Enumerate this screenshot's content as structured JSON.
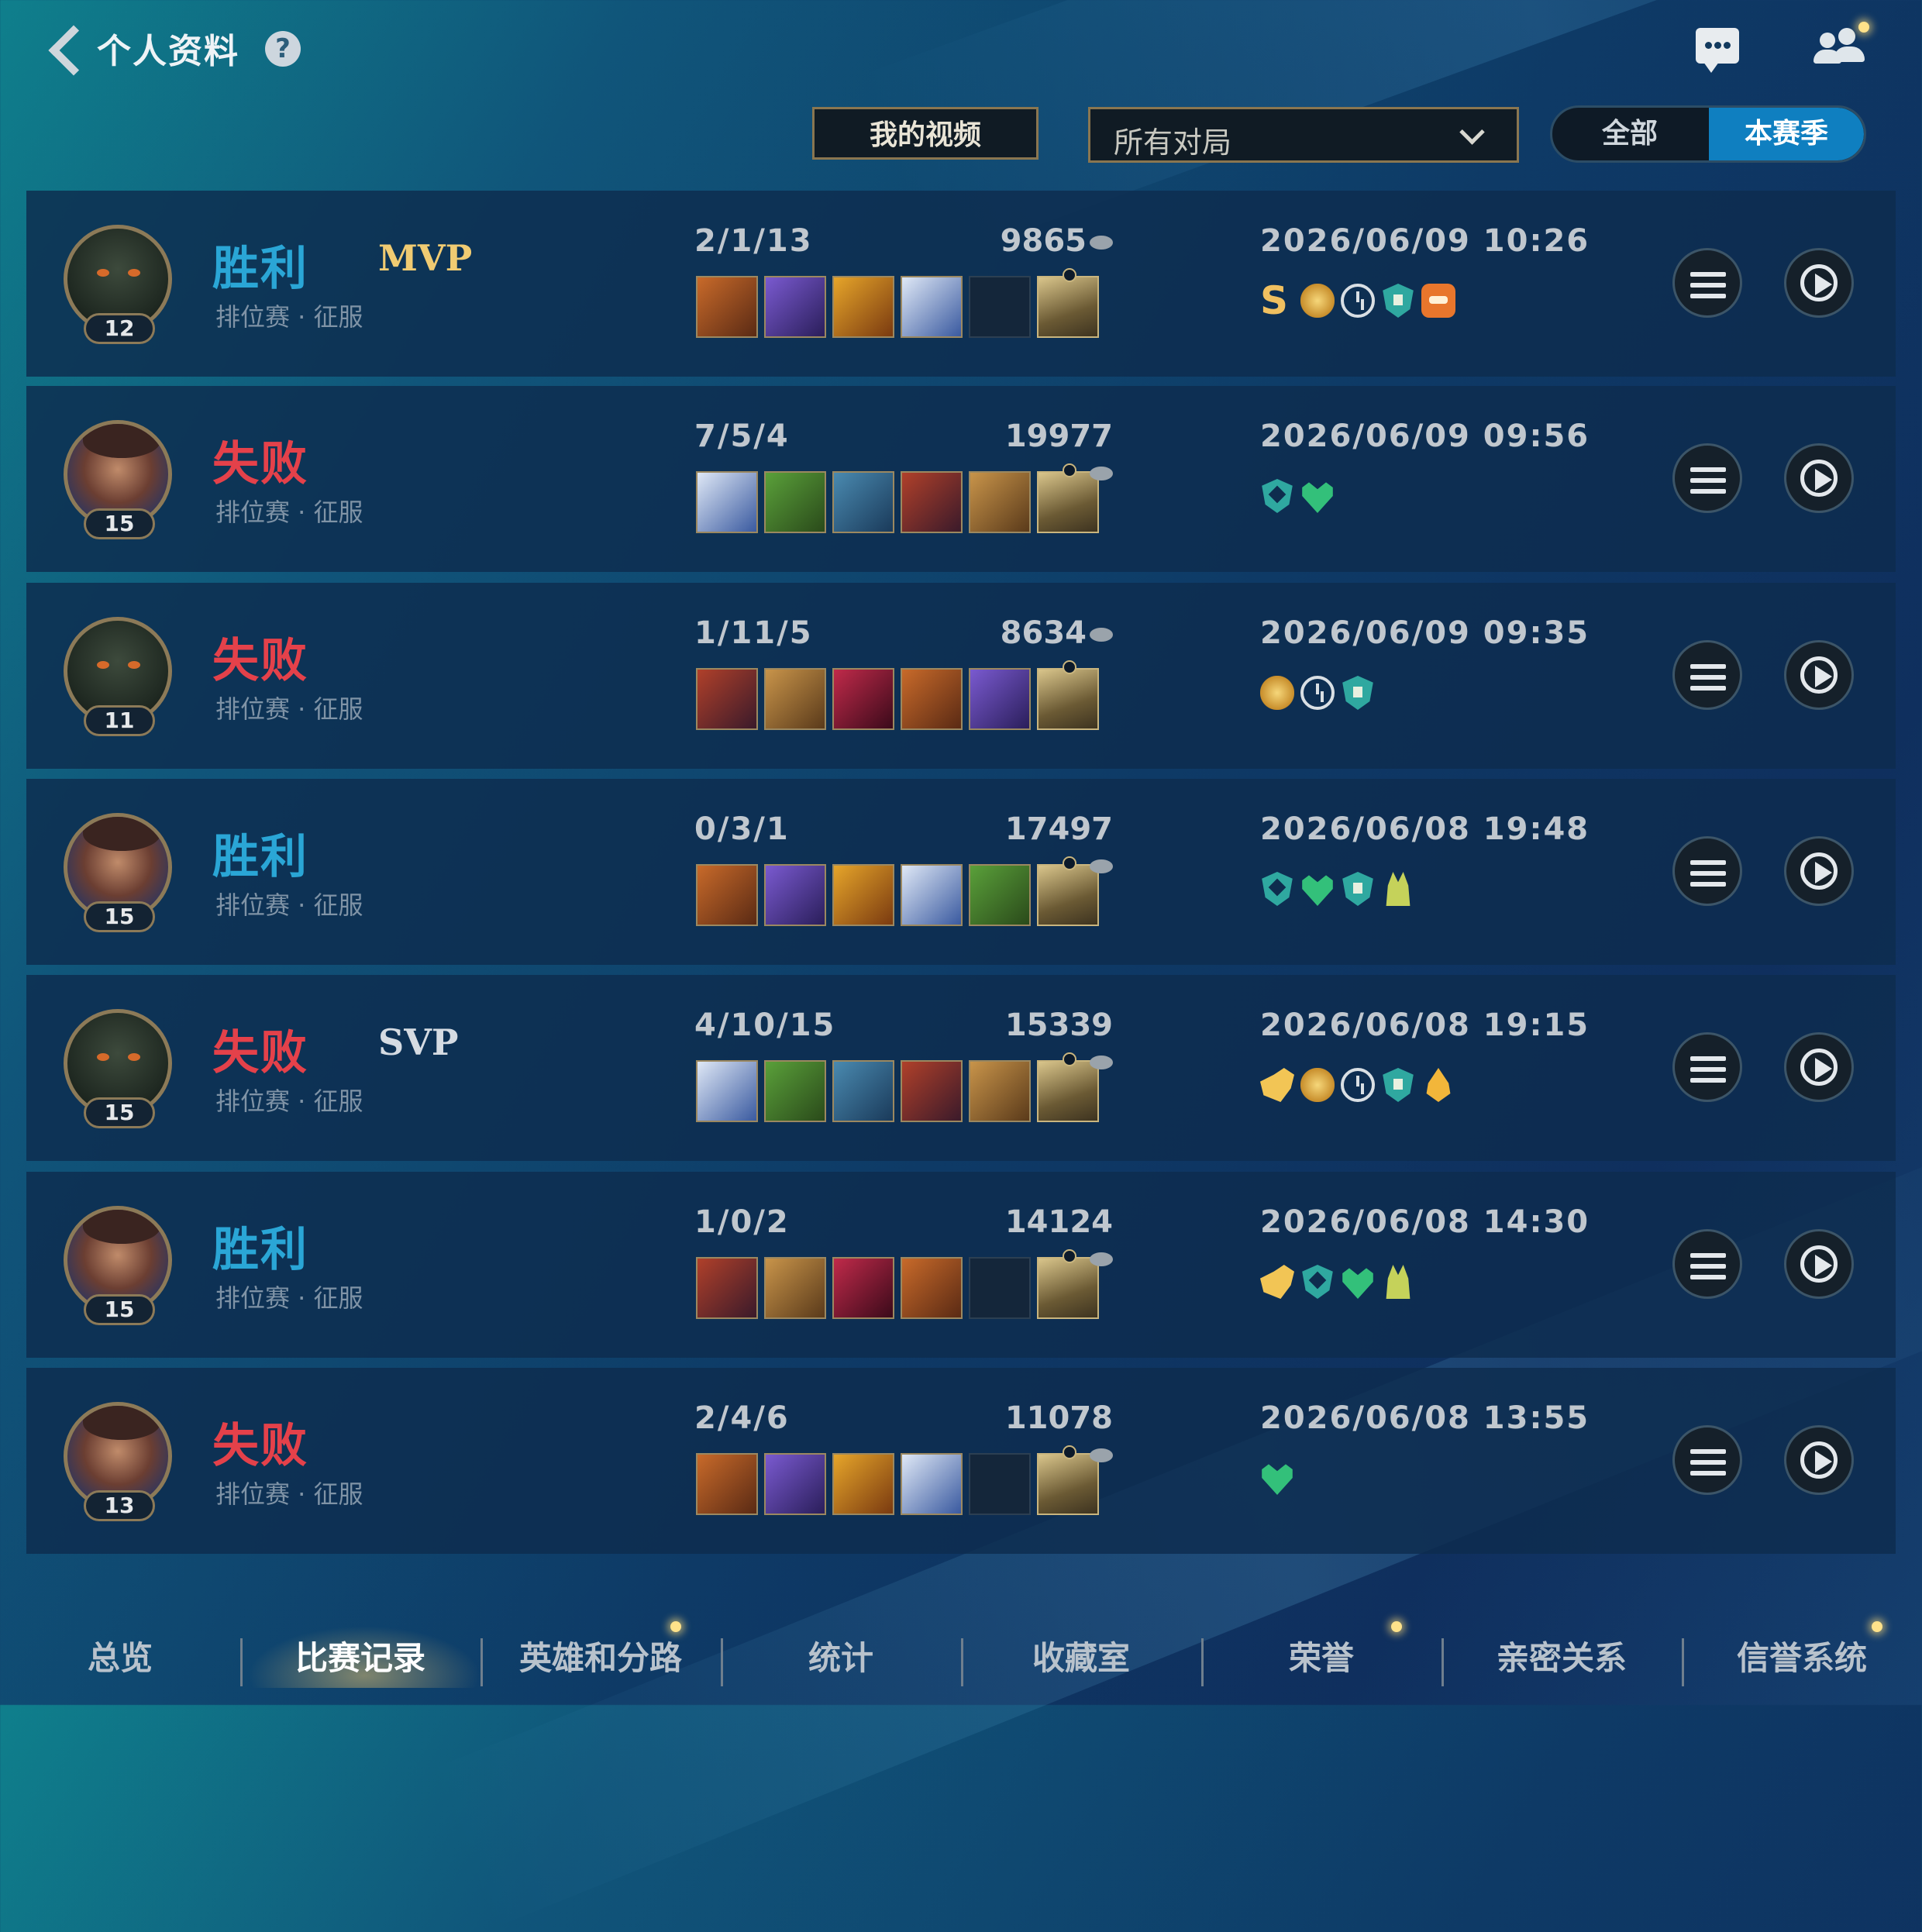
{
  "header": {
    "title": "个人资料",
    "help": "?"
  },
  "filters": {
    "my_video": "我的视频",
    "match_type": "所有对局",
    "toggle_all": "全部",
    "toggle_season": "本赛季"
  },
  "colors": {
    "win": "#2aa6d6",
    "loss": "#e4414a",
    "mvp": "#f0cb72",
    "accent_blue": "#0f7fc0"
  },
  "matches": [
    {
      "result": "胜利",
      "outcome": "win",
      "badge": "MVP",
      "mode": "排位赛 · 征服",
      "level": "12",
      "avatar": "champion-a",
      "kda": "2/1/13",
      "gold": "9865",
      "time": "2026/06/09 10:26",
      "awards": [
        "s-grade",
        "gold-hand-icon",
        "clock-icon",
        "tower-shield-icon",
        "orange-badge-icon"
      ],
      "items": [
        "item",
        "item",
        "item",
        "item",
        "empty",
        "trinket"
      ]
    },
    {
      "result": "失败",
      "outcome": "loss",
      "badge": "",
      "mode": "排位赛 · 征服",
      "level": "15",
      "avatar": "champion-b",
      "kda": "7/5/4",
      "gold": "19977",
      "time": "2026/06/09 09:56",
      "awards": [
        "shield-icon",
        "heal-heart-icon"
      ],
      "items": [
        "item",
        "item",
        "item",
        "item",
        "item",
        "trinket"
      ]
    },
    {
      "result": "失败",
      "outcome": "loss",
      "badge": "",
      "mode": "排位赛 · 征服",
      "level": "11",
      "avatar": "champion-a",
      "kda": "1/11/5",
      "gold": "8634",
      "time": "2026/06/09 09:35",
      "awards": [
        "gold-hand-icon",
        "clock-icon",
        "tower-shield-icon"
      ],
      "items": [
        "item",
        "item",
        "item",
        "item",
        "item",
        "trinket"
      ]
    },
    {
      "result": "胜利",
      "outcome": "win",
      "badge": "",
      "mode": "排位赛 · 征服",
      "level": "15",
      "avatar": "champion-b",
      "kda": "0/3/1",
      "gold": "17497",
      "time": "2026/06/08 19:48",
      "awards": [
        "shield-icon",
        "heal-heart-icon",
        "tower-shield-icon",
        "king-icon"
      ],
      "items": [
        "item",
        "item",
        "item",
        "item",
        "item",
        "trinket"
      ]
    },
    {
      "result": "失败",
      "outcome": "loss",
      "badge": "SVP",
      "mode": "排位赛 · 征服",
      "level": "15",
      "avatar": "champion-a",
      "kda": "4/10/15",
      "gold": "15339",
      "time": "2026/06/08 19:15",
      "awards": [
        "hand-icon",
        "gold-hand-icon",
        "clock-icon",
        "tower-shield-icon",
        "flame-icon"
      ],
      "items": [
        "item",
        "item",
        "item",
        "item",
        "item",
        "trinket"
      ]
    },
    {
      "result": "胜利",
      "outcome": "win",
      "badge": "",
      "mode": "排位赛 · 征服",
      "level": "15",
      "avatar": "champion-b",
      "kda": "1/0/2",
      "gold": "14124",
      "time": "2026/06/08 14:30",
      "awards": [
        "hand-icon",
        "shield-icon",
        "heal-heart-icon",
        "king-icon"
      ],
      "items": [
        "item",
        "item",
        "item",
        "item",
        "empty",
        "trinket"
      ]
    },
    {
      "result": "失败",
      "outcome": "loss",
      "badge": "",
      "mode": "排位赛 · 征服",
      "level": "13",
      "avatar": "champion-b",
      "kda": "2/4/6",
      "gold": "11078",
      "time": "2026/06/08 13:55",
      "awards": [
        "heal-heart-icon"
      ],
      "items": [
        "item",
        "item",
        "item",
        "item",
        "empty",
        "trinket"
      ]
    }
  ],
  "nav": [
    {
      "label": "总览",
      "active": false,
      "dot": false
    },
    {
      "label": "比赛记录",
      "active": true,
      "dot": false
    },
    {
      "label": "英雄和分路",
      "active": false,
      "dot": true
    },
    {
      "label": "统计",
      "active": false,
      "dot": false
    },
    {
      "label": "收藏室",
      "active": false,
      "dot": false
    },
    {
      "label": "荣誉",
      "active": false,
      "dot": true
    },
    {
      "label": "亲密关系",
      "active": false,
      "dot": false
    },
    {
      "label": "信誉系统",
      "active": false,
      "dot": true
    }
  ]
}
